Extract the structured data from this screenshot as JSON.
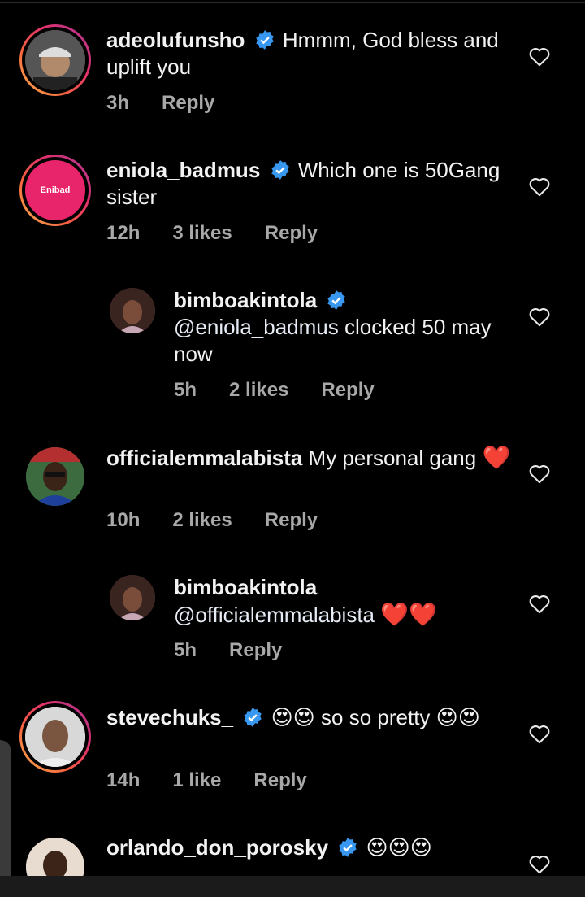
{
  "comments": [
    {
      "username": "adeolufunsho",
      "verified": true,
      "text": "Hmmm, God bless and uplift you",
      "time": "3h",
      "likes": "",
      "reply": "Reply",
      "avatar_icon": "person-in-cap-avatar"
    },
    {
      "username": "eniola_badmus",
      "verified": true,
      "text": "Which one is 50Gang sister",
      "time": "12h",
      "likes": "3 likes",
      "reply": "Reply",
      "avatar_icon": "brand-logo-avatar",
      "avatar_logo": "Enibad"
    },
    {
      "username": "bimboakintola",
      "verified": true,
      "mention": "@eniola_badmus",
      "text": "clocked 50 may now",
      "time": "5h",
      "likes": "2 likes",
      "reply": "Reply",
      "avatar_icon": "woman-avatar"
    },
    {
      "username": "officialemmalabista",
      "verified": false,
      "text": "My personal gang",
      "emoji": "❤️",
      "time": "10h",
      "likes": "2 likes",
      "reply": "Reply",
      "avatar_icon": "man-in-glasses-avatar"
    },
    {
      "username": "bimboakintola",
      "verified": false,
      "mention": "@officialemmalabista",
      "emoji": "❤️❤️",
      "time": "5h",
      "likes": "",
      "reply": "Reply",
      "avatar_icon": "woman-avatar"
    },
    {
      "username": "stevechuks_",
      "verified": true,
      "emoji_before": "😍😍",
      "text": "so so pretty",
      "emoji": "😍😍",
      "time": "14h",
      "likes": "1 like",
      "reply": "Reply",
      "avatar_icon": "man-portrait-avatar"
    },
    {
      "username": "orlando_don_porosky",
      "verified": true,
      "emoji": "😍😍😍",
      "avatar_icon": "older-man-avatar"
    }
  ],
  "colors": {
    "background": "#000000",
    "text": "#f2f2f2",
    "meta": "#a8a8a8",
    "verified": "#3897f0",
    "heart": "#e0202e"
  }
}
